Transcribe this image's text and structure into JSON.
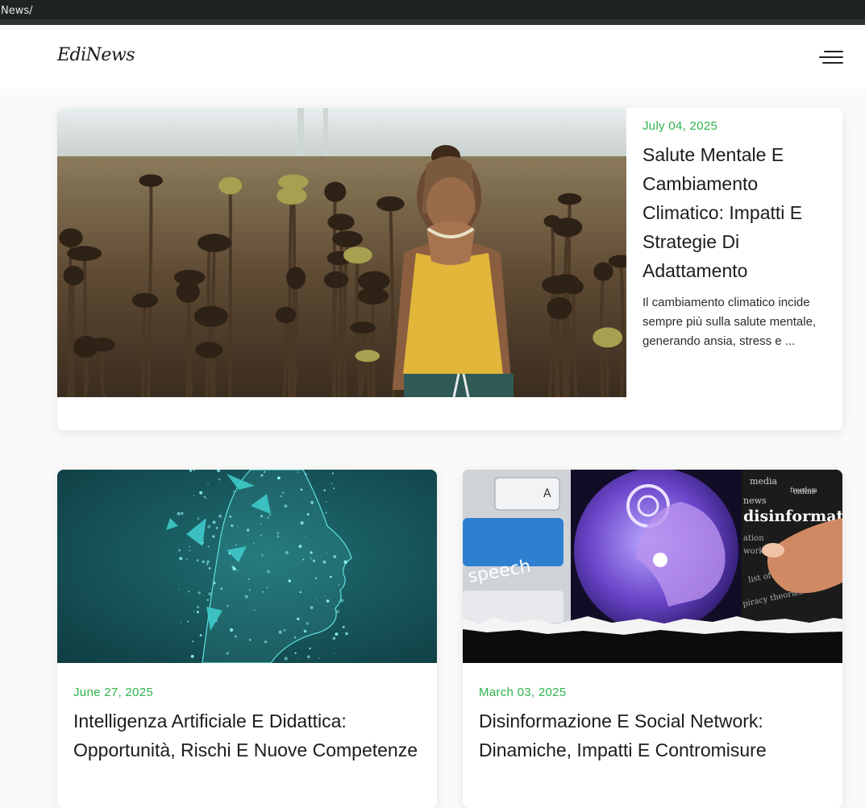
{
  "browser": {
    "breadcrumb": "News/"
  },
  "header": {
    "logo": "EdiNews"
  },
  "featured": {
    "date": "July 04, 2025",
    "title": "Salute Mentale E Cambiamento Climatico: Impatti E Strategie Di Adattamento",
    "excerpt": "Il cambiamento climatico incide sempre più sulla salute mentale, generando ansia, stress e ..."
  },
  "articles": [
    {
      "date": "June 27, 2025",
      "title": "Intelligenza Artificiale E Didattica: Opportunità, Rischi E Nuove Competenze"
    },
    {
      "date": "March 03, 2025",
      "title": "Disinformazione E Social Network: Dinamiche, Impatti E Contromisure"
    }
  ],
  "image_text": {
    "key_letter": "A",
    "key_label": "speech",
    "words": [
      "media",
      "online",
      "news",
      "freedom",
      "disinformation",
      "ation",
      "work",
      "list of officials",
      "piracy theories"
    ]
  },
  "colors": {
    "accent": "#2db34a",
    "topbar": "#1f2420"
  },
  "icons": {
    "menu": "hamburger-icon"
  }
}
